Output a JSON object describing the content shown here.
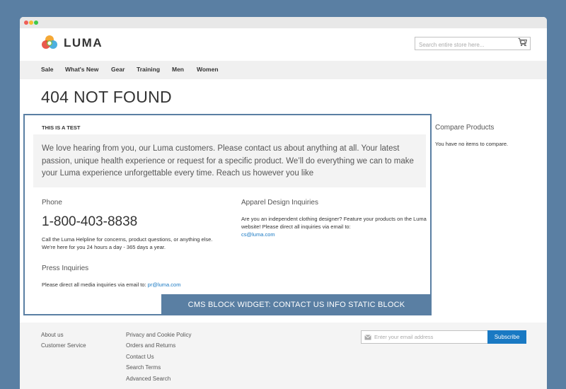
{
  "brand": {
    "name": "LUMA"
  },
  "search": {
    "placeholder": "Search entire store here..."
  },
  "nav": {
    "items": [
      "Sale",
      "What's New",
      "Gear",
      "Training",
      "Men",
      "Women"
    ]
  },
  "page": {
    "title": "404 NOT FOUND"
  },
  "widget": {
    "heading": "THIS IS A TEST",
    "intro": "We love hearing from you, our Luma customers. Please contact us about anything at all. Your latest passion, unique health experience or request for a specific product. We’ll do everything we can to make your Luma experience unforgettable every time. Reach us however you like",
    "phone": {
      "title": "Phone",
      "number": "1-800-403-8838",
      "text": "Call the Luma Helpline for concerns, product questions, or anything else. We’re here for you 24 hours a day - 365 days a year."
    },
    "apparel": {
      "title": "Apparel Design Inquiries",
      "text": "Are you an independent clothing designer? Feature your products on the Luma website! Please direct all inquiries via email to:",
      "email": "cs@luma.com"
    },
    "press": {
      "title": "Press Inquiries",
      "text": "Please direct all media inquiries via email to: ",
      "email": "pr@luma.com"
    },
    "banner": "CMS BLOCK WIDGET: CONTACT US INFO STATIC BLOCK"
  },
  "compare": {
    "title": "Compare Products",
    "empty": "You have no items to compare."
  },
  "footer": {
    "col1": [
      "About us",
      "Customer Service"
    ],
    "col2": [
      "Privacy and Cookie Policy",
      "Orders and Returns",
      "Contact Us",
      "Search Terms",
      "Advanced Search"
    ],
    "newsletter_placeholder": "Enter your email address",
    "subscribe_label": "Subscribe"
  },
  "colors": {
    "accent": "#1979c3",
    "widget_border": "#5a7fa3",
    "background": "#5a7fa3"
  }
}
